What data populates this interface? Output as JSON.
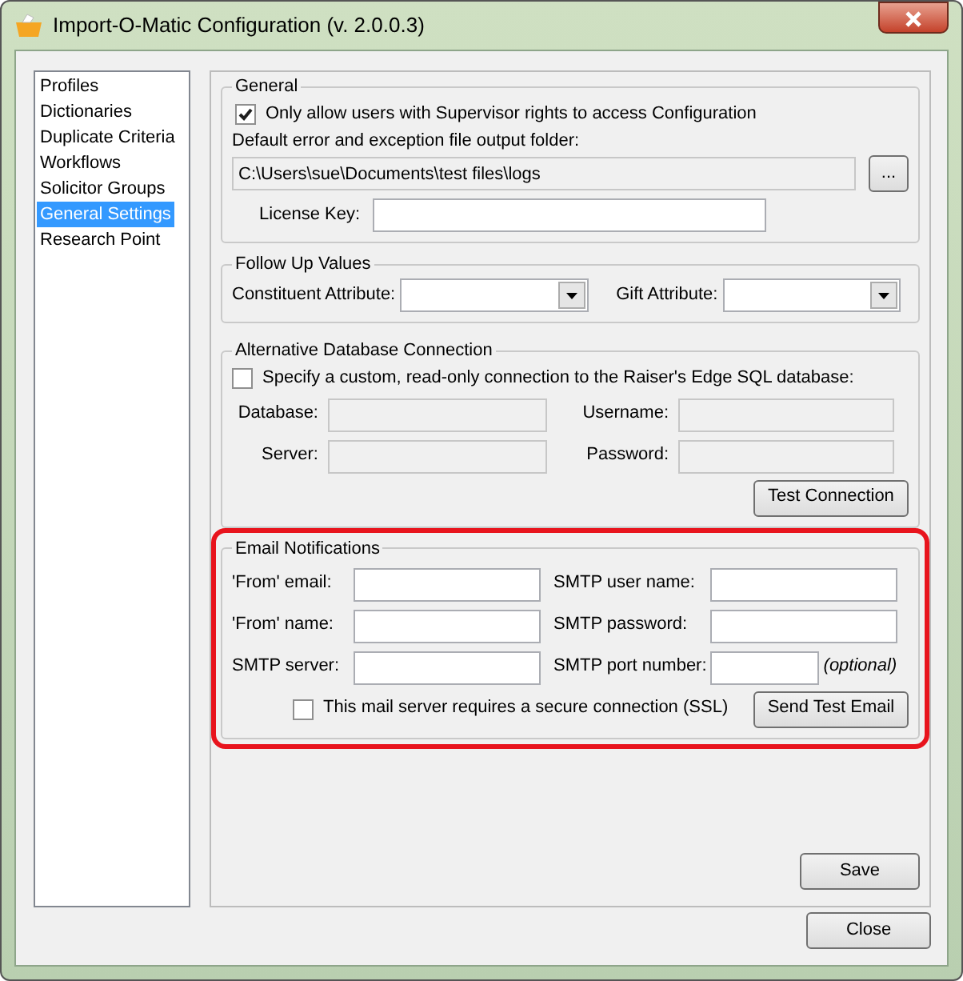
{
  "window": {
    "title": "Import-O-Matic Configuration (v. 2.0.0.3)"
  },
  "sidebar": {
    "items": [
      {
        "label": "Profiles",
        "selected": false
      },
      {
        "label": "Dictionaries",
        "selected": false
      },
      {
        "label": "Duplicate Criteria",
        "selected": false
      },
      {
        "label": "Workflows",
        "selected": false
      },
      {
        "label": "Solicitor Groups",
        "selected": false
      },
      {
        "label": "General Settings",
        "selected": true
      },
      {
        "label": "Research Point",
        "selected": false
      }
    ]
  },
  "general": {
    "title": "General",
    "supervisor_only": {
      "label": "Only allow users with Supervisor rights to access Configuration",
      "checked": true
    },
    "folder_label": "Default error and exception file output folder:",
    "folder_value": "C:\\Users\\sue\\Documents\\test files\\logs",
    "folder_disabled": true,
    "browse_button": "...",
    "license_label": "License Key:"
  },
  "follow_up": {
    "title": "Follow Up Values",
    "fields": [
      {
        "label": "Constituent Attribute:"
      },
      {
        "label": "Gift Attribute:"
      }
    ]
  },
  "alt_db": {
    "title": "Alternative Database Connection",
    "custom": {
      "label": "Specify a custom, read-only connection to the Raiser's Edge SQL database:",
      "checked": false
    },
    "fields": [
      {
        "label": "Database:",
        "disabled": true
      },
      {
        "label": "Username:",
        "disabled": true
      },
      {
        "label": "Server:",
        "disabled": true
      },
      {
        "label": "Password:",
        "disabled": true
      }
    ],
    "button": "Test Connection"
  },
  "email": {
    "title": "Email Notifications",
    "highlighted": true,
    "fields": [
      {
        "label": "'From' email:"
      },
      {
        "label": "SMTP user name:"
      },
      {
        "label": "'From' name:"
      },
      {
        "label": "SMTP password:"
      },
      {
        "label": "SMTP server:"
      },
      {
        "label": "SMTP port number:",
        "note": "(optional)"
      }
    ],
    "ssl": {
      "label": "This mail server requires a secure connection (SSL)",
      "checked": false
    },
    "button": "Send Test Email"
  },
  "buttons": {
    "save": "Save",
    "close": "Close"
  }
}
